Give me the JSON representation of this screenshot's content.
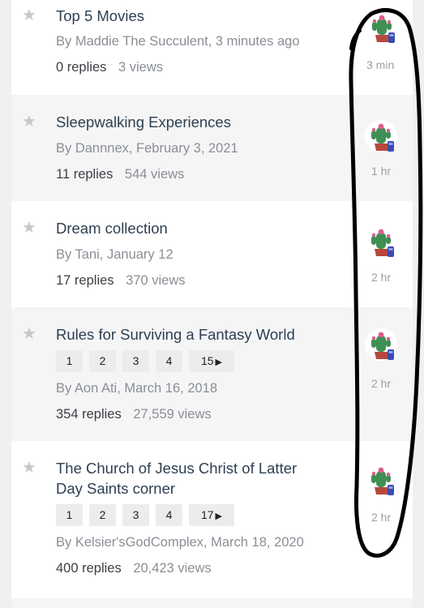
{
  "topics": [
    {
      "title": "Top 5 Movies",
      "byline": "By Maddie The Succulent, 3 minutes ago",
      "replies": "0 replies",
      "views": "3 views",
      "time": "3 min",
      "pages": []
    },
    {
      "title": "Sleepwalking Experiences",
      "byline": "By Dannnex, February 3, 2021",
      "replies": "11 replies",
      "views": "544 views",
      "time": "1 hr",
      "pages": []
    },
    {
      "title": "Dream collection",
      "byline": "By Tani, January 12",
      "replies": "17 replies",
      "views": "370 views",
      "time": "2 hr",
      "pages": []
    },
    {
      "title": "Rules for Surviving a Fantasy World",
      "byline": "By Aon Ati, March 16, 2018",
      "replies": "354 replies",
      "views": "27,559 views",
      "time": "2 hr",
      "pages": [
        "1",
        "2",
        "3",
        "4",
        "15"
      ]
    },
    {
      "title": "The Church of Jesus Christ of Latter Day Saints corner",
      "byline": "By Kelsier'sGodComplex, March 18, 2020",
      "replies": "400 replies",
      "views": "20,423 views",
      "time": "2 hr",
      "pages": [
        "1",
        "2",
        "3",
        "4",
        "17"
      ]
    }
  ],
  "icons": {
    "star": "star-icon",
    "last_page": "triangle-right-icon",
    "avatar": "cactus-avatar"
  },
  "colors": {
    "title": "#2d3f52",
    "muted": "#8a8f96",
    "annotation": "#000000"
  }
}
